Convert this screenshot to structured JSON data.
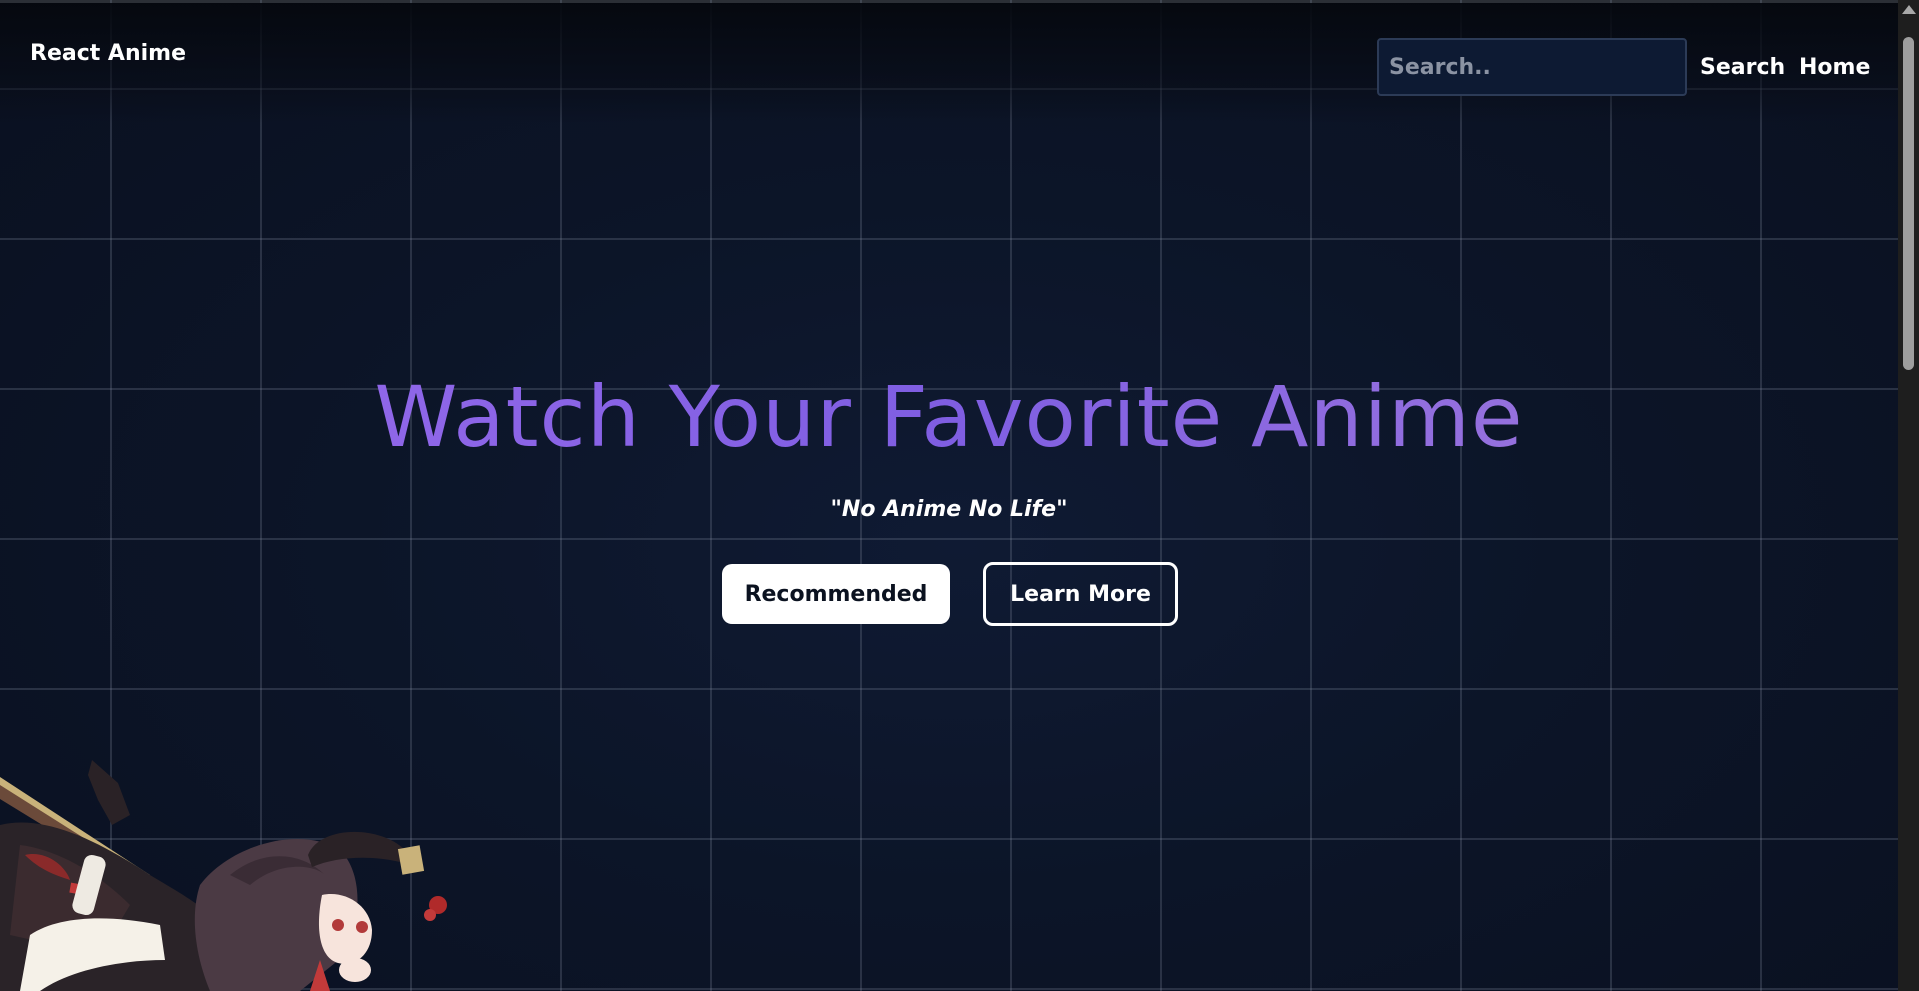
{
  "header": {
    "brand": "React Anime",
    "search_placeholder": "Search..",
    "nav": [
      {
        "label": "Search"
      },
      {
        "label": "Home"
      }
    ]
  },
  "hero": {
    "title": "Watch Your Favorite Anime",
    "tagline": "\"No Anime No Life\"",
    "buttons": {
      "primary": "Recommended",
      "secondary": "Learn More"
    }
  },
  "colors": {
    "background": "#0b1220",
    "title_gradient_start": "#9a6cec",
    "title_gradient_end": "#a47ddb",
    "text": "#ffffff"
  }
}
